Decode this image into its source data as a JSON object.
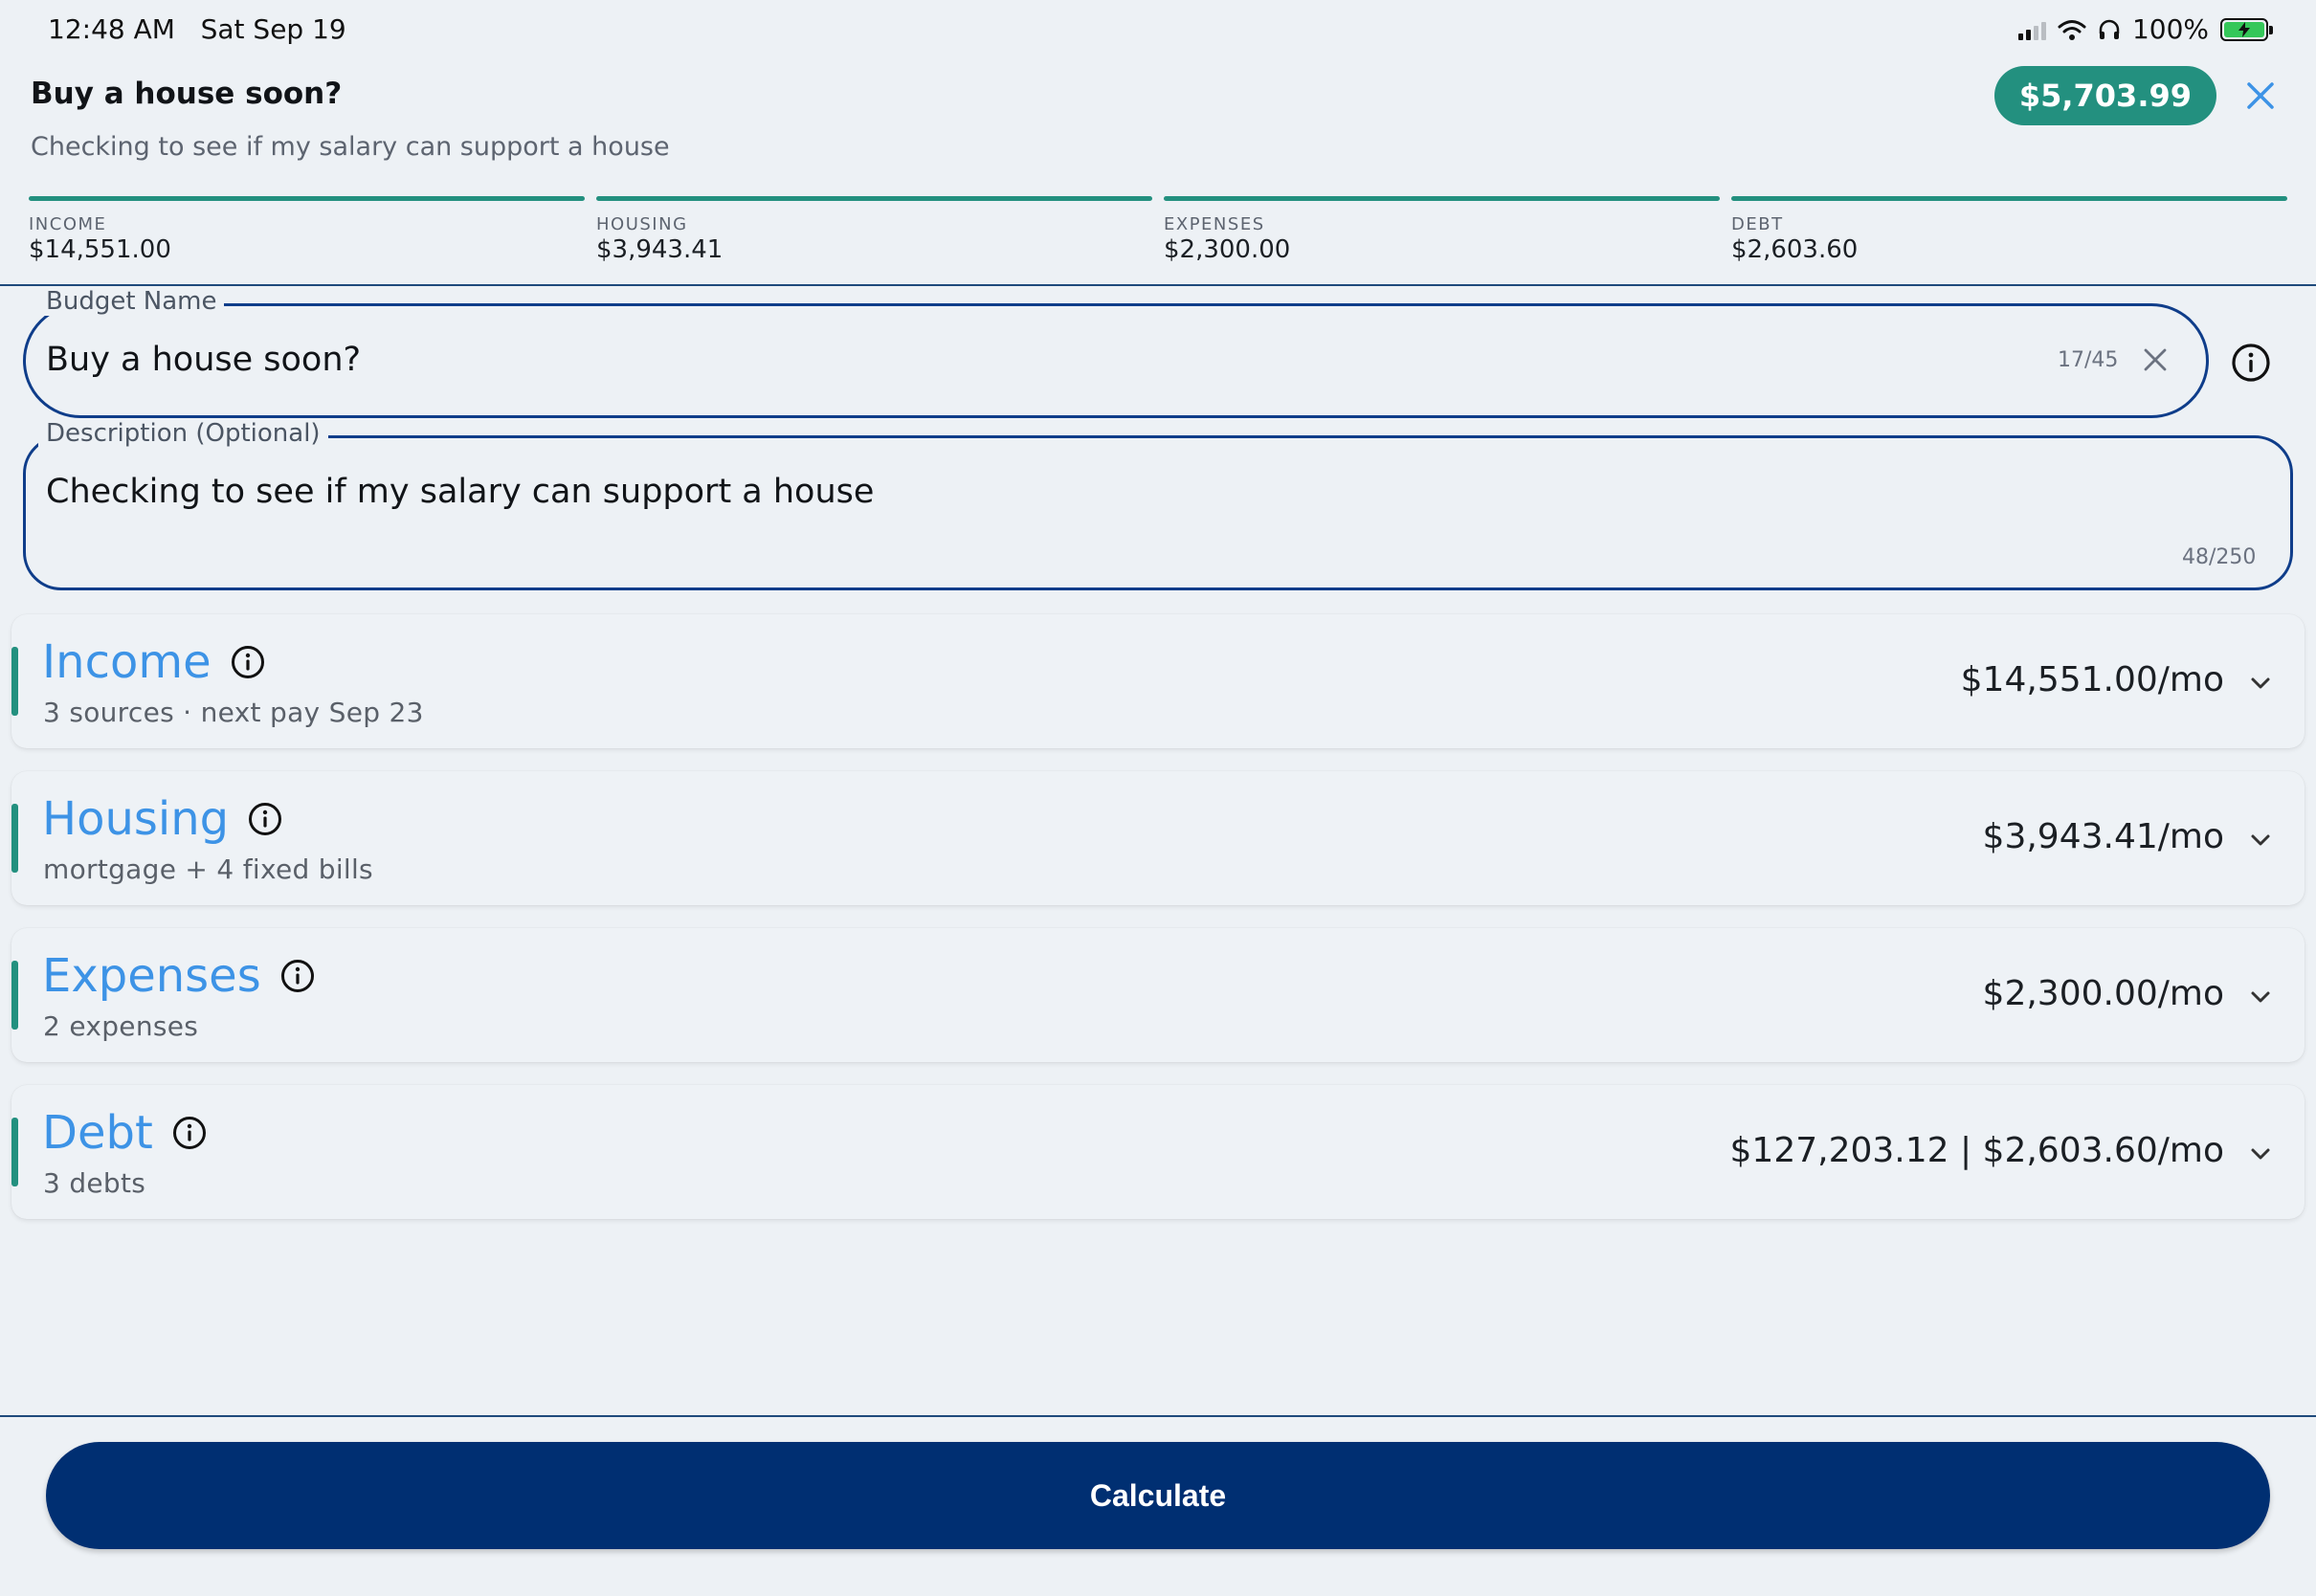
{
  "status": {
    "time": "12:48 AM",
    "date": "Sat Sep 19",
    "battery": "100%"
  },
  "header": {
    "title": "Buy a house soon?",
    "subtitle": "Checking to see if my salary can support a house",
    "total": "$5,703.99"
  },
  "summary": [
    {
      "label": "INCOME",
      "value": "$14,551.00"
    },
    {
      "label": "HOUSING",
      "value": "$3,943.41"
    },
    {
      "label": "EXPENSES",
      "value": "$2,300.00"
    },
    {
      "label": "DEBT",
      "value": "$2,603.60"
    }
  ],
  "form": {
    "name_label": "Budget Name",
    "name_value": "Buy a house soon?",
    "name_count": "17/45",
    "desc_label": "Description (Optional)",
    "desc_value": "Checking to see if my salary can support a house",
    "desc_count": "48/250"
  },
  "cards": [
    {
      "title": "Income",
      "subtitle": "3 sources · next pay Sep 23",
      "amount": "$14,551.00/mo"
    },
    {
      "title": "Housing",
      "subtitle": "mortgage + 4 fixed bills",
      "amount": "$3,943.41/mo"
    },
    {
      "title": "Expenses",
      "subtitle": "2 expenses",
      "amount": "$2,300.00/mo"
    },
    {
      "title": "Debt",
      "subtitle": "3 debts",
      "amount": "$127,203.12 | $2,603.60/mo"
    }
  ],
  "actions": {
    "calculate": "Calculate"
  },
  "colors": {
    "accent": "#23907f",
    "primary": "#002f72",
    "title_blue": "#3d93e6",
    "outline": "#0f3d8a"
  }
}
